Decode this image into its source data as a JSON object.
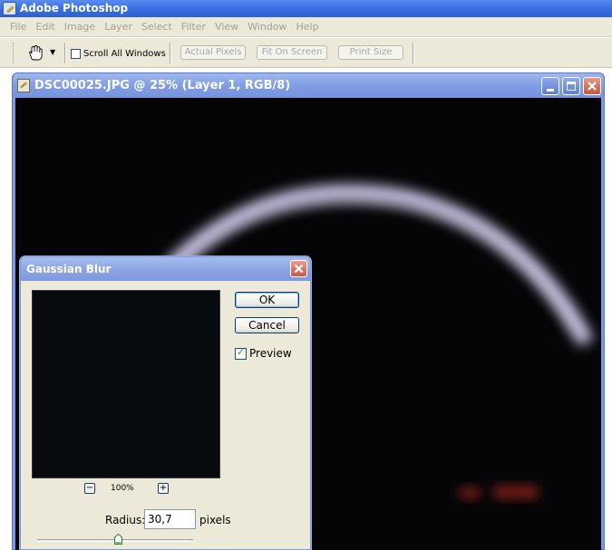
{
  "app": {
    "title": "Adobe Photoshop"
  },
  "menu": [
    "File",
    "Edit",
    "Image",
    "Layer",
    "Select",
    "Filter",
    "View",
    "Window",
    "Help"
  ],
  "options": {
    "tool_icon": "hand-icon",
    "scroll_all_label": "Scroll All Windows",
    "scroll_all_checked": false,
    "buttons": [
      "Actual Pixels",
      "Fit On Screen",
      "Print Size"
    ]
  },
  "document": {
    "title": "DSC00025.JPG @ 25% (Layer 1, RGB/8)",
    "zoom": "25%"
  },
  "dialog": {
    "title": "Gaussian Blur",
    "ok_label": "OK",
    "cancel_label": "Cancel",
    "preview_label": "Preview",
    "preview_checked": true,
    "zoom_level": "100%",
    "zoom_out_symbol": "−",
    "zoom_in_symbol": "+",
    "radius_label": "Radius:",
    "radius_value": "30,7",
    "radius_unit": "pixels"
  },
  "colors": {
    "titlebar": "#3b6fe0",
    "doc_titlebar": "#7f9be2",
    "canvas_bg": "#050507",
    "arc": "#c8c2e4",
    "glow": "#7a1e12"
  }
}
